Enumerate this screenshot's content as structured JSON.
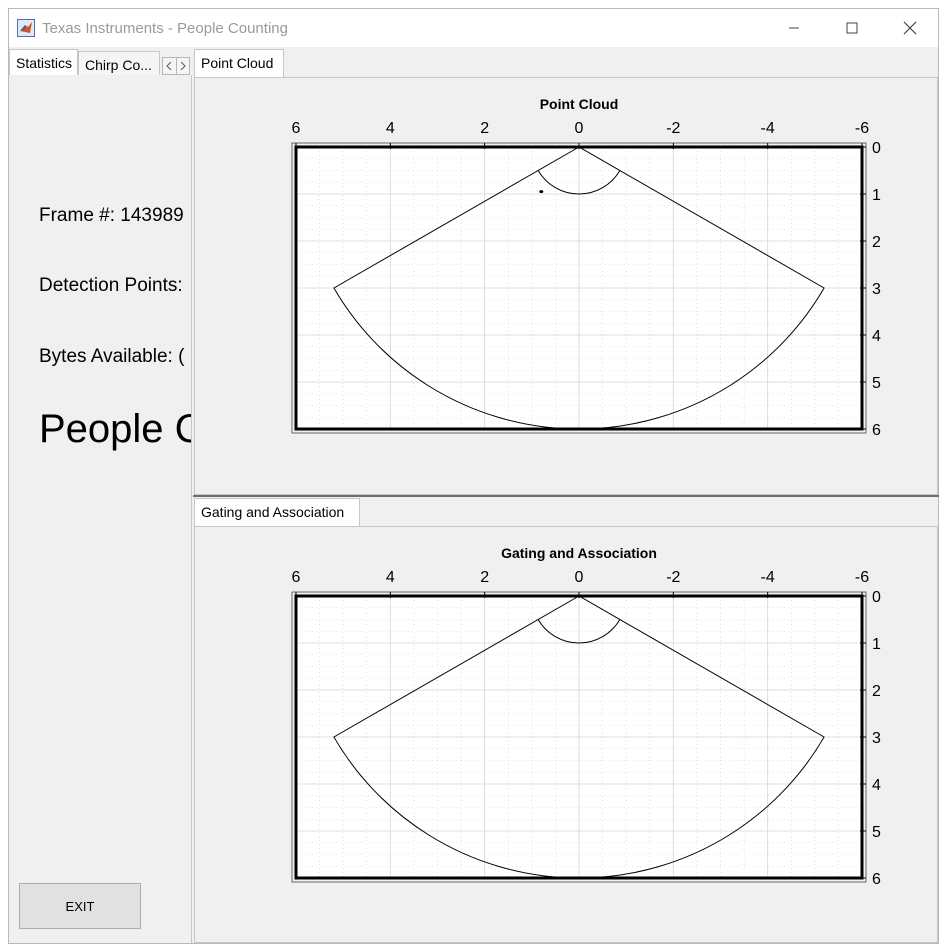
{
  "window": {
    "title": "Texas Instruments - People Counting"
  },
  "left_tabs": [
    {
      "label": "Statistics"
    },
    {
      "label": "Chirp Co..."
    }
  ],
  "stats": {
    "frame": "Frame #: 143989",
    "detection_points": "Detection Points:",
    "bytes_available": "Bytes Available: (",
    "people": "People C"
  },
  "exit_label": "EXIT",
  "point_cloud_tab": "Point Cloud",
  "gating_tab": "Gating and Association",
  "colors": {
    "frame": "#000000",
    "grid": "#d6d6d6",
    "point": "#000000"
  },
  "chart_data": [
    {
      "type": "scatter",
      "title": "Point Cloud",
      "x_ticks": [
        "6",
        "4",
        "2",
        "0",
        "-2",
        "-4",
        "-6"
      ],
      "y_ticks": [
        "0",
        "1",
        "2",
        "3",
        "4",
        "5",
        "6"
      ],
      "xlim": [
        6,
        -6
      ],
      "ylim": [
        0,
        6
      ],
      "x_axis_location": "top",
      "y_axis_location": "right",
      "grid": true,
      "minor_grid": true,
      "points": [
        {
          "x": 0.8,
          "y": 0.95
        }
      ]
    },
    {
      "type": "scatter",
      "title": "Gating and Association",
      "x_ticks": [
        "6",
        "4",
        "2",
        "0",
        "-2",
        "-4",
        "-6"
      ],
      "y_ticks": [
        "0",
        "1",
        "2",
        "3",
        "4",
        "5",
        "6"
      ],
      "xlim": [
        6,
        -6
      ],
      "ylim": [
        0,
        6
      ],
      "x_axis_location": "top",
      "y_axis_location": "right",
      "grid": true,
      "minor_grid": true,
      "points": []
    }
  ]
}
